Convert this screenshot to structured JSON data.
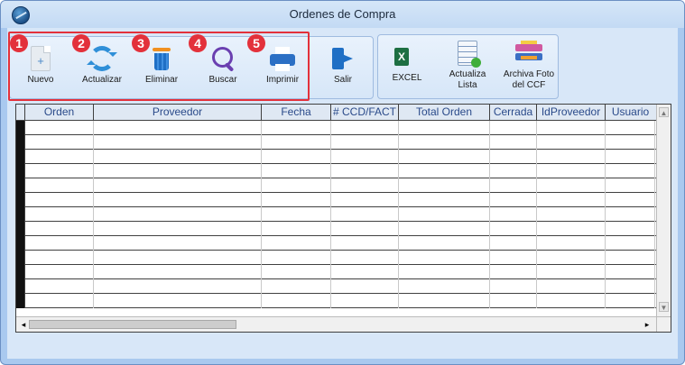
{
  "window": {
    "title": "Ordenes de Compra"
  },
  "toolbar": {
    "buttons": [
      {
        "label": "Nuevo",
        "badge": "1"
      },
      {
        "label": "Actualizar",
        "badge": "2"
      },
      {
        "label": "Eliminar",
        "badge": "3"
      },
      {
        "label": "Buscar",
        "badge": "4"
      },
      {
        "label": "Imprimir",
        "badge": "5"
      },
      {
        "label": "Salir"
      },
      {
        "label": "EXCEL"
      },
      {
        "label": "Actualiza Lista"
      },
      {
        "label": "Archiva Foto del CCF"
      }
    ]
  },
  "grid": {
    "columns": [
      "Orden",
      "Proveedor",
      "Fecha",
      "# CCD/FACT",
      "Total Orden",
      "Cerrada",
      "IdProveedor",
      "Usuario"
    ],
    "rows": [
      [],
      [],
      [],
      [],
      [],
      [],
      [],
      [],
      [],
      [],
      [],
      [],
      []
    ]
  },
  "colors": {
    "callout": "#e3313b",
    "header_text": "#2a4a8a",
    "background": "#d8e7f8"
  }
}
